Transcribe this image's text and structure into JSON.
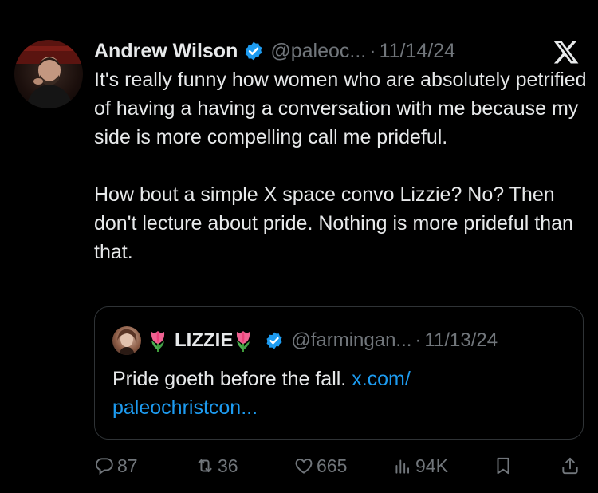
{
  "tweet": {
    "author_name": "Andrew Wilson",
    "handle": "@paleoc...",
    "separator": "·",
    "date": "11/14/24",
    "paragraphs": [
      "It's really funny how women who are absolutely petrified of having a having a conversation with me because my side is more compelling call me prideful.",
      "How bout a simple X space convo Lizzie? No? Then don't lecture about pride. Nothing is more prideful than that."
    ]
  },
  "quoted": {
    "author_name": "LIZZIE",
    "handle": "@farmingan...",
    "separator": "·",
    "date": "11/13/24",
    "text": "Pride goeth before the fall. ",
    "link_text": "x.com/\npaleochristcon..."
  },
  "actions": {
    "replies": "87",
    "reposts": "36",
    "likes": "665",
    "views": "94K"
  },
  "icons": [
    "x-logo-icon",
    "verified-badge-icon",
    "tulip-emoji-icon",
    "reply-icon",
    "repost-icon",
    "like-icon",
    "views-icon",
    "bookmark-icon",
    "share-icon"
  ],
  "colors": {
    "background": "#000000",
    "text": "#e7e9ea",
    "muted": "#71767b",
    "accent": "#1d9bf0",
    "border": "#2f3336"
  }
}
